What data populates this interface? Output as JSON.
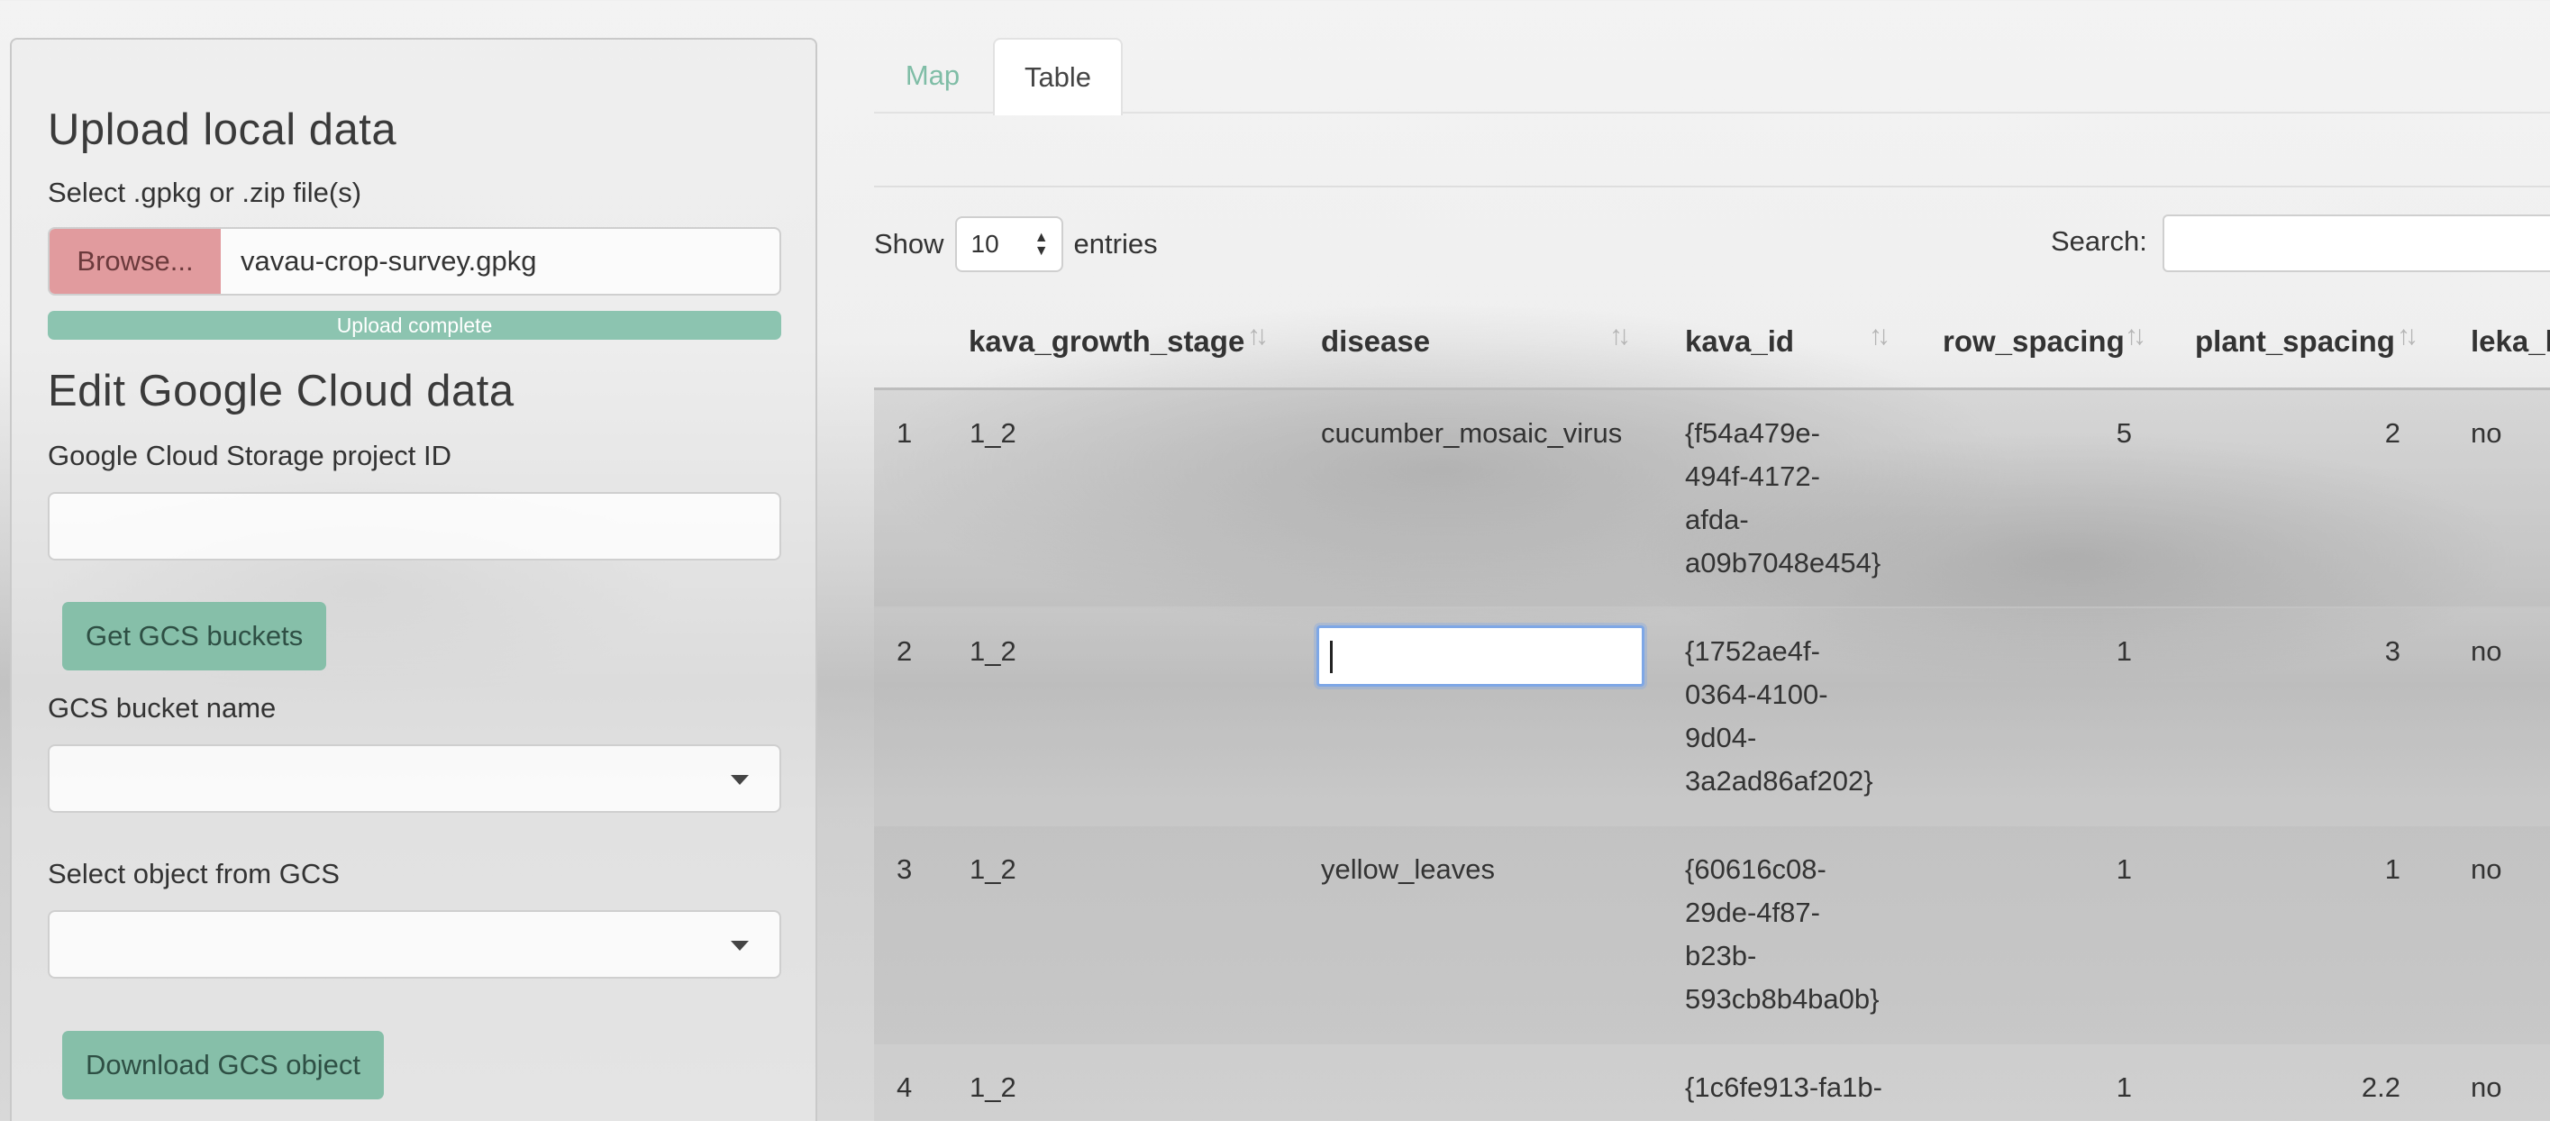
{
  "sidebar": {
    "upload_heading": "Upload local data",
    "select_file_label": "Select .gpkg or .zip file(s)",
    "browse_label": "Browse...",
    "file_name": "vavau-crop-survey.gpkg",
    "progress_label": "Upload complete",
    "progress_value": 1.0,
    "edit_heading": "Edit Google Cloud data",
    "project_id_label": "Google Cloud Storage project ID",
    "project_id_value": "",
    "get_buckets_label": "Get GCS buckets",
    "bucket_label": "GCS bucket name",
    "bucket_value": "",
    "object_label": "Select object from GCS",
    "object_value": "",
    "download_label": "Download GCS object"
  },
  "tabs": [
    {
      "label": "Map",
      "active": false
    },
    {
      "label": "Table",
      "active": true
    }
  ],
  "table_controls": {
    "show_label": "Show",
    "entries_value": "10",
    "entries_label": "entries",
    "search_label": "Search:",
    "search_value": ""
  },
  "columns": [
    "",
    "kava_growth_stage",
    "disease",
    "kava_id",
    "row_spacing",
    "plant_spacing",
    "leka_l"
  ],
  "rows": [
    {
      "index": "1",
      "kava_growth_stage": "1_2",
      "disease": "cucumber_mosaic_virus",
      "kava_id": "{f54a479e-\n494f-4172-\nafda-\na09b7048e454}",
      "row_spacing": "5",
      "plant_spacing": "2",
      "leka": "no"
    },
    {
      "index": "2",
      "kava_growth_stage": "1_2",
      "disease": "",
      "kava_id": "{1752ae4f-\n0364-4100-\n9d04-\n3a2ad86af202}",
      "row_spacing": "1",
      "plant_spacing": "3",
      "leka": "no"
    },
    {
      "index": "3",
      "kava_growth_stage": "1_2",
      "disease": "yellow_leaves",
      "kava_id": "{60616c08-\n29de-4f87-\nb23b-\n593cb8b4ba0b}",
      "row_spacing": "1",
      "plant_spacing": "1",
      "leka": "no"
    },
    {
      "index": "4",
      "kava_growth_stage": "1_2",
      "disease": "",
      "kava_id": "{1c6fe913-fa1b-",
      "row_spacing": "1",
      "plant_spacing": "2.2",
      "leka": "no"
    }
  ],
  "colors": {
    "accent": "#86bfa9",
    "browse": "#e19b9e",
    "focus": "#7ea7e6"
  }
}
